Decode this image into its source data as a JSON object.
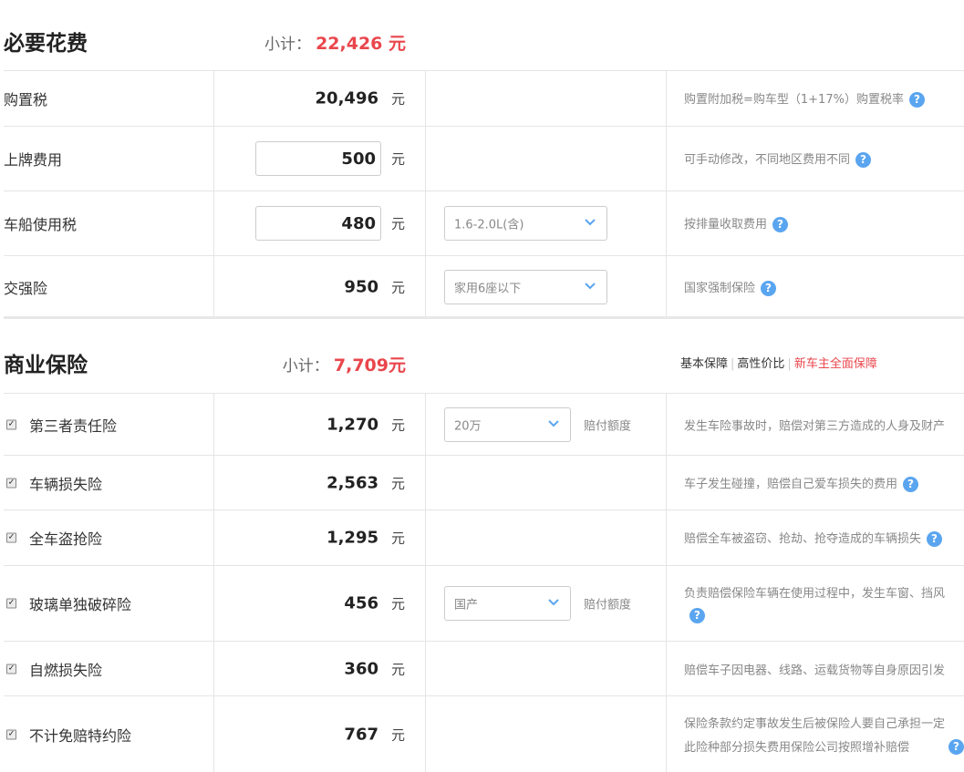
{
  "required": {
    "title": "必要花费",
    "subtotal_label": "小计：",
    "subtotal_value": "22,426 元",
    "rows": [
      {
        "name": "购置税",
        "amount": "20,496",
        "unit": "元",
        "desc": "购置附加税=购车型（1+17%）购置税率"
      },
      {
        "name": "上牌费用",
        "amount": "500",
        "unit": "元",
        "desc": "可手动修改，不同地区费用不同"
      },
      {
        "name": "车船使用税",
        "amount": "480",
        "unit": "元",
        "select": "1.6-2.0L(含)",
        "desc": "按排量收取费用"
      },
      {
        "name": "交强险",
        "amount": "950",
        "unit": "元",
        "select": "家用6座以下",
        "desc": "国家强制保险"
      }
    ]
  },
  "commercial": {
    "title": "商业保险",
    "subtotal_label": "小计：",
    "subtotal_value": "7,709元",
    "plans": [
      "基本保障",
      "高性价比",
      "新车主全面保障"
    ],
    "rows": [
      {
        "name": "第三者责任险",
        "amount": "1,270",
        "unit": "元",
        "select": "20万",
        "extra": "赔付额度",
        "desc": "发生车险事故时，赔偿对第三方造成的人身及财产"
      },
      {
        "name": "车辆损失险",
        "amount": "2,563",
        "unit": "元",
        "desc": "车子发生碰撞，赔偿自己爱车损失的费用"
      },
      {
        "name": "全车盗抢险",
        "amount": "1,295",
        "unit": "元",
        "desc": "赔偿全车被盗窃、抢劫、抢夺造成的车辆损失"
      },
      {
        "name": "玻璃单独破碎险",
        "amount": "456",
        "unit": "元",
        "select": "国产",
        "extra": "赔付额度",
        "desc": "负责赔偿保险车辆在使用过程中，发生车窗、挡风"
      },
      {
        "name": "自燃损失险",
        "amount": "360",
        "unit": "元",
        "desc": "赔偿车子因电器、线路、运载货物等自身原因引发"
      },
      {
        "name": "不计免赔特约险",
        "amount": "767",
        "unit": "元",
        "desc": "保险条款约定事故发生后被保险人要自己承担一定",
        "desc_line2": "此险种部分损失费用保险公司按照增补赔偿"
      }
    ]
  },
  "icons": {
    "help": "help-circle-icon",
    "chevron": "chevron-down-icon",
    "checkbox": "checkbox-checked-icon"
  },
  "colors": {
    "accent_red": "#e9464c",
    "help_blue": "#5aa5f0",
    "border": "#e5e5e5"
  }
}
